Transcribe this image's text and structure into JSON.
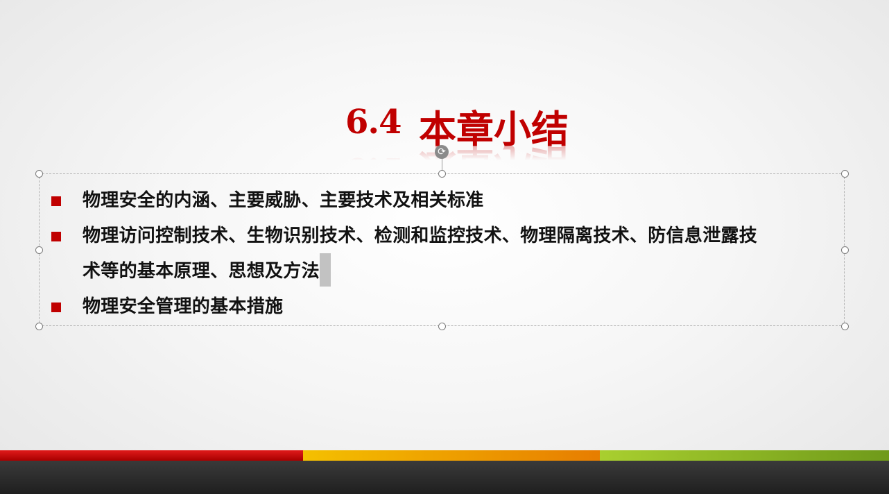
{
  "slide": {
    "title": {
      "number": "6.4",
      "text": "本章小结",
      "color": "#c00000"
    },
    "bullets": [
      {
        "text": "物理安全的内涵、主要威胁、主要技术及相关标准"
      },
      {
        "line1": "物理访问控制技术、生物识别技术、检测和监控技术、物理隔离技术、防信息泄露技",
        "line2": "术等的基本原理、思想及方法"
      },
      {
        "text": "物理安全管理的基本措施"
      }
    ],
    "bullet_color": "#c00000",
    "bottom_bar_colors": [
      "#c00000",
      "#f0a000",
      "#8ab825",
      "#2a2a2a"
    ],
    "icons": {
      "rotate": "rotate-icon",
      "bullet": "square-bullet-icon"
    }
  }
}
